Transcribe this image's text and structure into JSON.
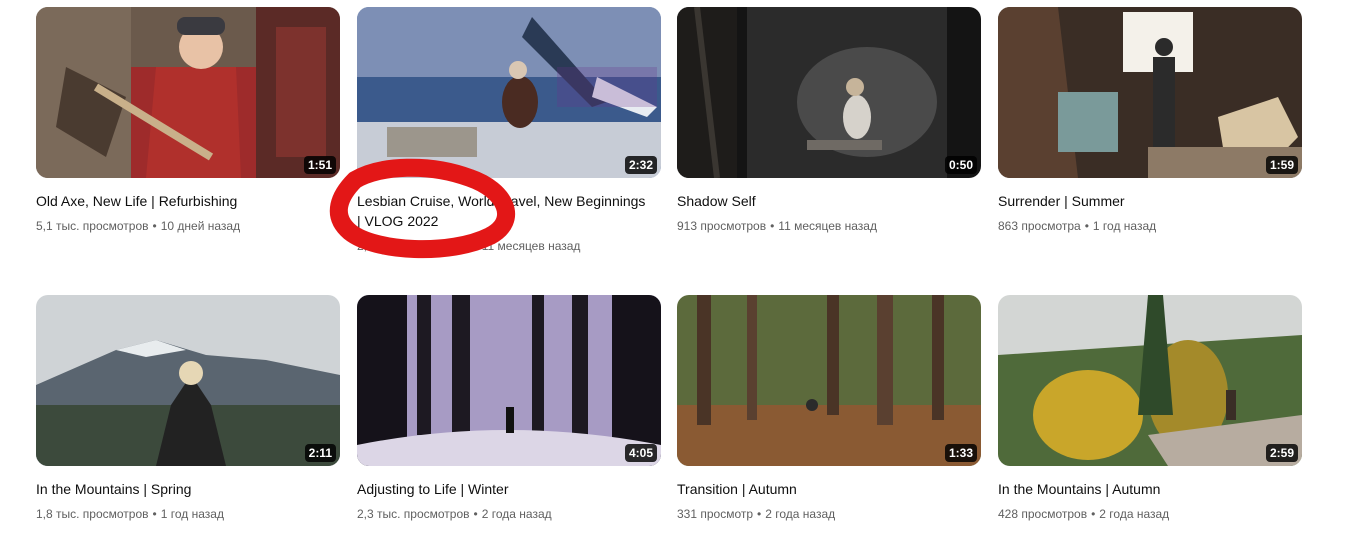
{
  "videos": [
    {
      "title": "Old Axe, New Life | Refurbishing",
      "views": "5,1 тыс. просмотров",
      "age": "10 дней назад",
      "duration": "1:51"
    },
    {
      "title": "Lesbian Cruise, World Travel, New Beginnings | VLOG 2022",
      "views": "2,9 тыс. просмотров",
      "age": "11 месяцев назад",
      "duration": "2:32"
    },
    {
      "title": "Shadow Self",
      "views": "913 просмотров",
      "age": "11 месяцев назад",
      "duration": "0:50"
    },
    {
      "title": "Surrender | Summer",
      "views": "863 просмотра",
      "age": "1 год назад",
      "duration": "1:59"
    },
    {
      "title": "In the Mountains | Spring",
      "views": "1,8 тыс. просмотров",
      "age": "1 год назад",
      "duration": "2:11"
    },
    {
      "title": "Adjusting to Life | Winter",
      "views": "2,3 тыс. просмотров",
      "age": "2 года назад",
      "duration": "4:05"
    },
    {
      "title": "Transition | Autumn",
      "views": "331 просмотр",
      "age": "2 года назад",
      "duration": "1:33"
    },
    {
      "title": "In the Mountains | Autumn",
      "views": "428 просмотров",
      "age": "2 года назад",
      "duration": "2:59"
    }
  ],
  "separator": "•",
  "annotation": {
    "shape": "hand-drawn ellipse",
    "color": "#e31717"
  }
}
